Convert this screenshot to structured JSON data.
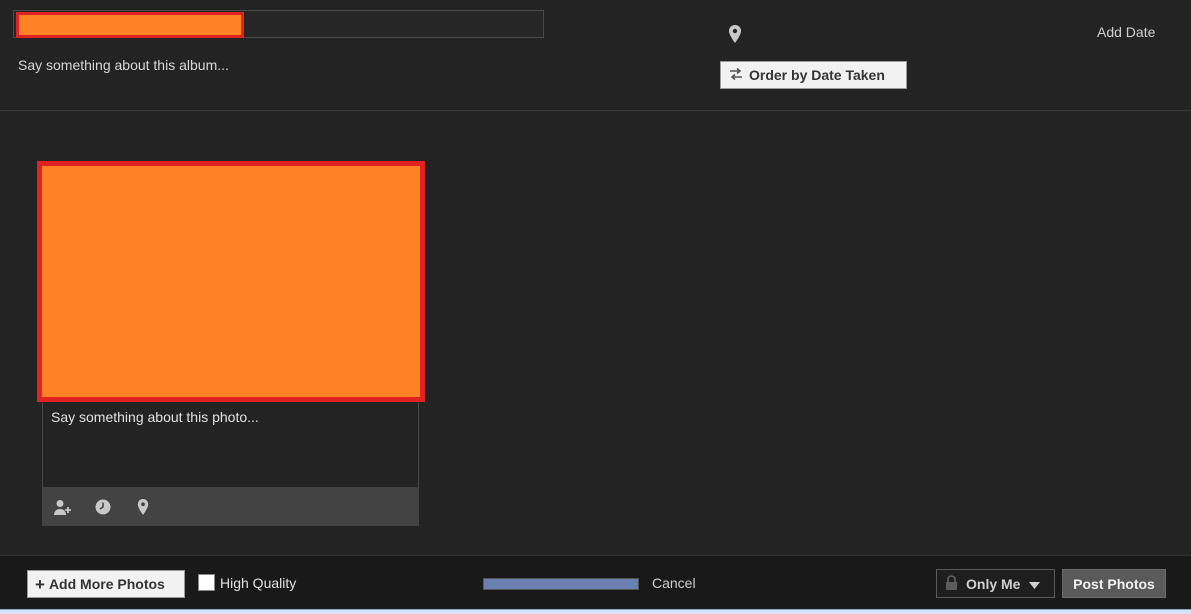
{
  "header": {
    "album_title_value": "",
    "album_description_placeholder": "Say something about this album...",
    "add_date_label": "Add Date",
    "order_button_label": "Order by Date Taken"
  },
  "photo": {
    "caption_placeholder": "Say something about this photo...",
    "tools": [
      "tag-person-icon",
      "clock-icon",
      "location-pin-icon"
    ]
  },
  "footer": {
    "add_more_label": "Add More Photos",
    "high_quality_label": "High Quality",
    "high_quality_checked": false,
    "upload_progress": 1.0,
    "cancel_label": "Cancel",
    "privacy_label": "Only Me",
    "post_label": "Post Photos"
  },
  "colors": {
    "background": "#232323",
    "redaction_fill": "#ff8324",
    "redaction_border": "#e02222",
    "progress_fill": "#6b7fb0"
  }
}
